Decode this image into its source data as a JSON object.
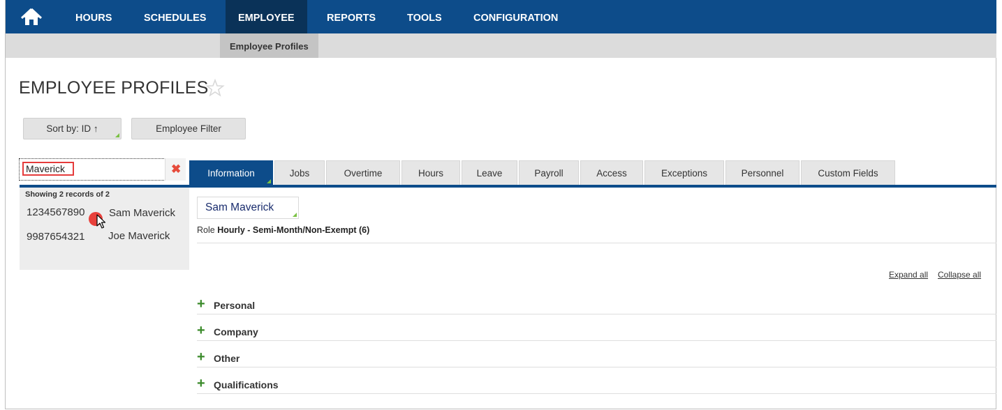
{
  "nav": {
    "home_icon": "home-icon",
    "items": [
      "HOURS",
      "SCHEDULES",
      "EMPLOYEE",
      "REPORTS",
      "TOOLS",
      "CONFIGURATION"
    ],
    "active": "EMPLOYEE",
    "bg_color": "#0d4c8a"
  },
  "subnav": {
    "active_item": "Employee Profiles"
  },
  "page": {
    "title": "EMPLOYEE PROFILES"
  },
  "toolbar": {
    "sort_label": "Sort by: ID ↑",
    "filter_label": "Employee Filter"
  },
  "search": {
    "value": "Maverick",
    "clear_icon": "close-icon"
  },
  "results": {
    "count_text": "Showing 2 records of 2",
    "records": [
      {
        "id": "1234567890",
        "name": "Sam Maverick"
      },
      {
        "id": "9987654321",
        "name": "Joe Maverick"
      }
    ]
  },
  "tabs": [
    "Information",
    "Jobs",
    "Overtime",
    "Hours",
    "Leave",
    "Payroll",
    "Access",
    "Exceptions",
    "Personnel",
    "Custom Fields"
  ],
  "active_tab": "Information",
  "profile": {
    "name": "Sam Maverick",
    "role_label": "Role",
    "role_value": "Hourly - Semi-Month/Non-Exempt (6)"
  },
  "actions": {
    "expand_all": "Expand all",
    "collapse_all": "Collapse all"
  },
  "sections": [
    "Personal",
    "Company",
    "Other",
    "Qualifications"
  ],
  "colors": {
    "accent_green": "#7ac143",
    "clear_red": "#e64b3b"
  }
}
